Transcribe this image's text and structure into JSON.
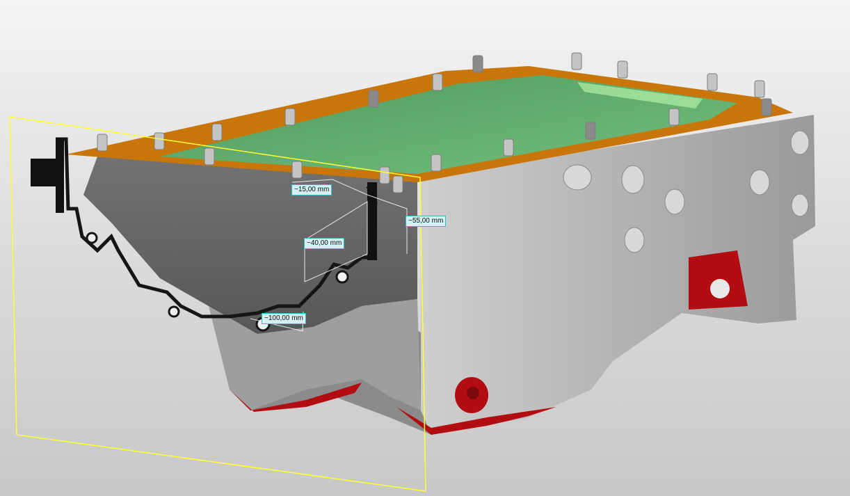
{
  "viewport": {
    "background_top": "#f4f4f4",
    "background_bottom": "#c8c8c8"
  },
  "colors": {
    "flange": "#c8760a",
    "inner_surface": "#5fa86a",
    "body": "#a9a9a9",
    "body_shadow": "#6e6e6e",
    "machined_faces": "#b10d12",
    "section_plane": "#ffff33",
    "dimension_box": "#35b8c4"
  },
  "model": {
    "name": "oil-pan",
    "section_view": true
  },
  "dimensions": [
    {
      "id": "dim-15",
      "label": "~15,00 mm"
    },
    {
      "id": "dim-55",
      "label": "~55,00 mm"
    },
    {
      "id": "dim-40",
      "label": "~40,00 mm"
    },
    {
      "id": "dim-100",
      "label": "~100,00 mm"
    }
  ]
}
